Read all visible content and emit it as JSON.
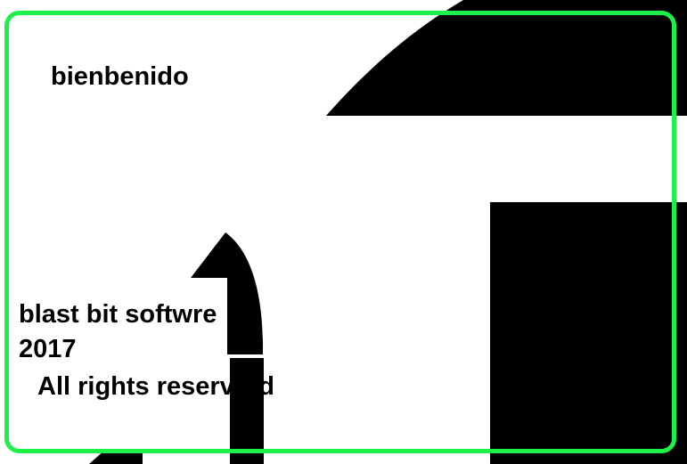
{
  "welcome_text": "bienbenido",
  "company_text": "blast bit softwre",
  "year_text": "2017",
  "rights_text": "All rights reserverd",
  "colors": {
    "frame": "#1ef04a",
    "shapes": "#000000",
    "background": "#ffffff",
    "text": "#000000"
  }
}
